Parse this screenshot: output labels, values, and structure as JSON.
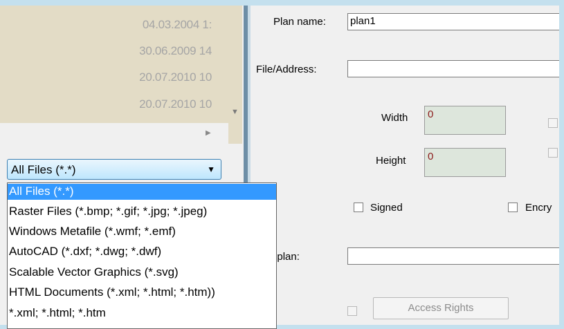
{
  "file_list": {
    "dates": [
      "04.03.2004 1:",
      "30.06.2009 14",
      "20.07.2010 10",
      "20.07.2010 10"
    ]
  },
  "filter": {
    "selected": "All Files (*.*)",
    "options": [
      "All Files (*.*)",
      "Raster Files (*.bmp; *.gif; *.jpg; *.jpeg)",
      "Windows Metafile (*.wmf; *.emf)",
      "AutoCAD (*.dxf; *.dwg; *.dwf)",
      "Scalable Vector Graphics (*.svg)",
      "HTML Documents (*.xml; *.html; *.htm))",
      "*.xml; *.html; *.htm"
    ]
  },
  "form": {
    "plan_name_label": "Plan name:",
    "plan_name_value": "plan1",
    "file_address_label": "File/Address:",
    "file_address_value": "",
    "width_label": "Width",
    "width_value": "0",
    "height_label": "Height",
    "height_value": "0",
    "signed_label": "Signed",
    "encrypted_label": "Encry",
    "parent_plan_label": "arent plan:",
    "parent_plan_value": "",
    "access_rights_label": "Access Rights"
  },
  "icons": {
    "scroll_down": "triangle-down-icon",
    "scroll_right": "triangle-right-icon",
    "combo_arrow": "chevron-down-icon"
  },
  "colors": {
    "selection": "#3399ff",
    "list_background": "#e3dcc6",
    "numeric_field": "#dde6dc"
  }
}
